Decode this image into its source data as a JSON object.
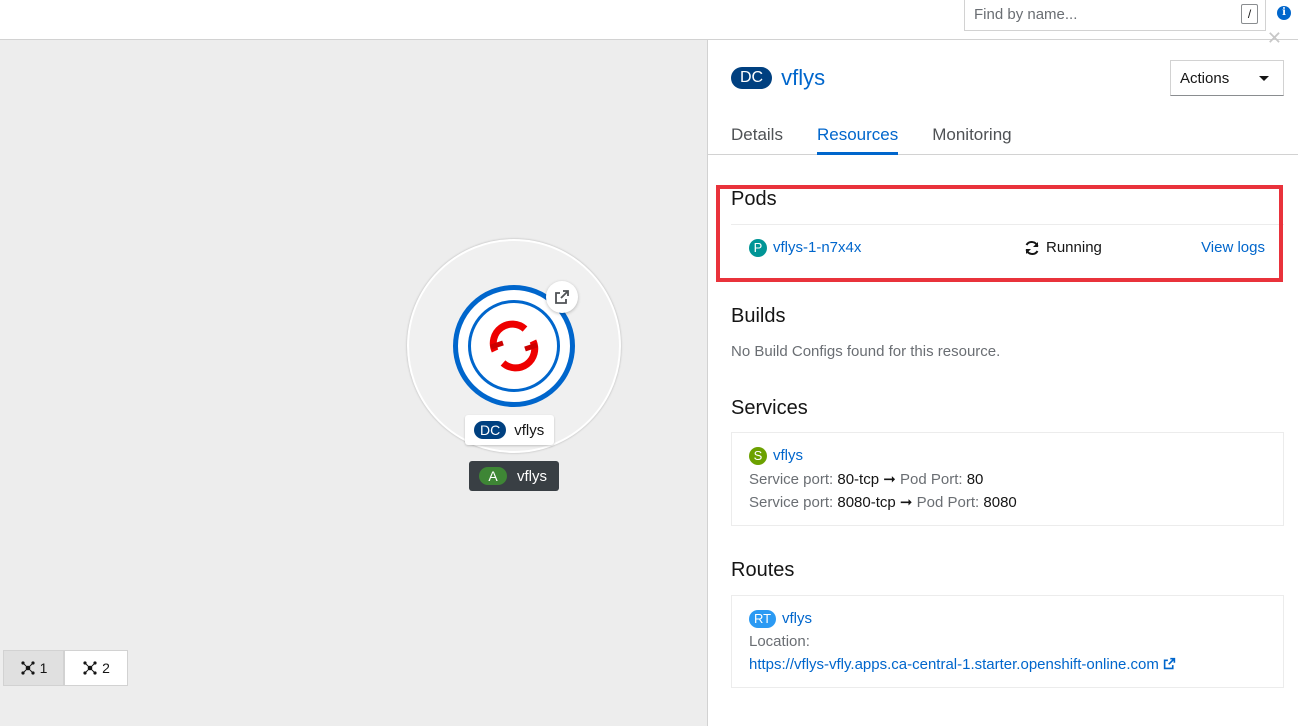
{
  "search": {
    "placeholder": "Find by name...",
    "shortcut": "/"
  },
  "header": {
    "info_icon": "info-icon"
  },
  "topology": {
    "node": {
      "kind_badge": "DC",
      "name": "vflys",
      "icon": "openshift-logo"
    },
    "application": {
      "kind_badge": "A",
      "name": "vflys"
    },
    "toolbar": [
      {
        "label": "1",
        "icon": "topology-icon"
      },
      {
        "label": "2",
        "icon": "topology-icon"
      }
    ]
  },
  "panel": {
    "kind_badge": "DC",
    "title": "vflys",
    "actions_label": "Actions",
    "tabs": [
      "Details",
      "Resources",
      "Monitoring"
    ],
    "active_tab": "Resources",
    "pods": {
      "title": "Pods",
      "items": [
        {
          "badge": "P",
          "name": "vflys-1-n7x4x",
          "status": "Running",
          "action": "View logs"
        }
      ]
    },
    "builds": {
      "title": "Builds",
      "empty_text": "No Build Configs found for this resource."
    },
    "services": {
      "title": "Services",
      "items": [
        {
          "badge": "S",
          "name": "vflys",
          "ports": [
            {
              "service_label": "Service port:",
              "service_port": "80-tcp",
              "pod_label": "Pod Port:",
              "pod_port": "80"
            },
            {
              "service_label": "Service port:",
              "service_port": "8080-tcp",
              "pod_label": "Pod Port:",
              "pod_port": "8080"
            }
          ]
        }
      ]
    },
    "routes": {
      "title": "Routes",
      "items": [
        {
          "badge": "RT",
          "name": "vflys",
          "location_label": "Location:",
          "url": "https://vflys-vfly.apps.ca-central-1.starter.openshift-online.com"
        }
      ]
    }
  },
  "colors": {
    "accent": "#0066cc",
    "dc_badge": "#004080",
    "app_badge": "#3e8635",
    "pod_badge": "#009596",
    "service_badge": "#6ca100",
    "route_badge": "#2b9af3",
    "highlight": "#e9323b"
  }
}
